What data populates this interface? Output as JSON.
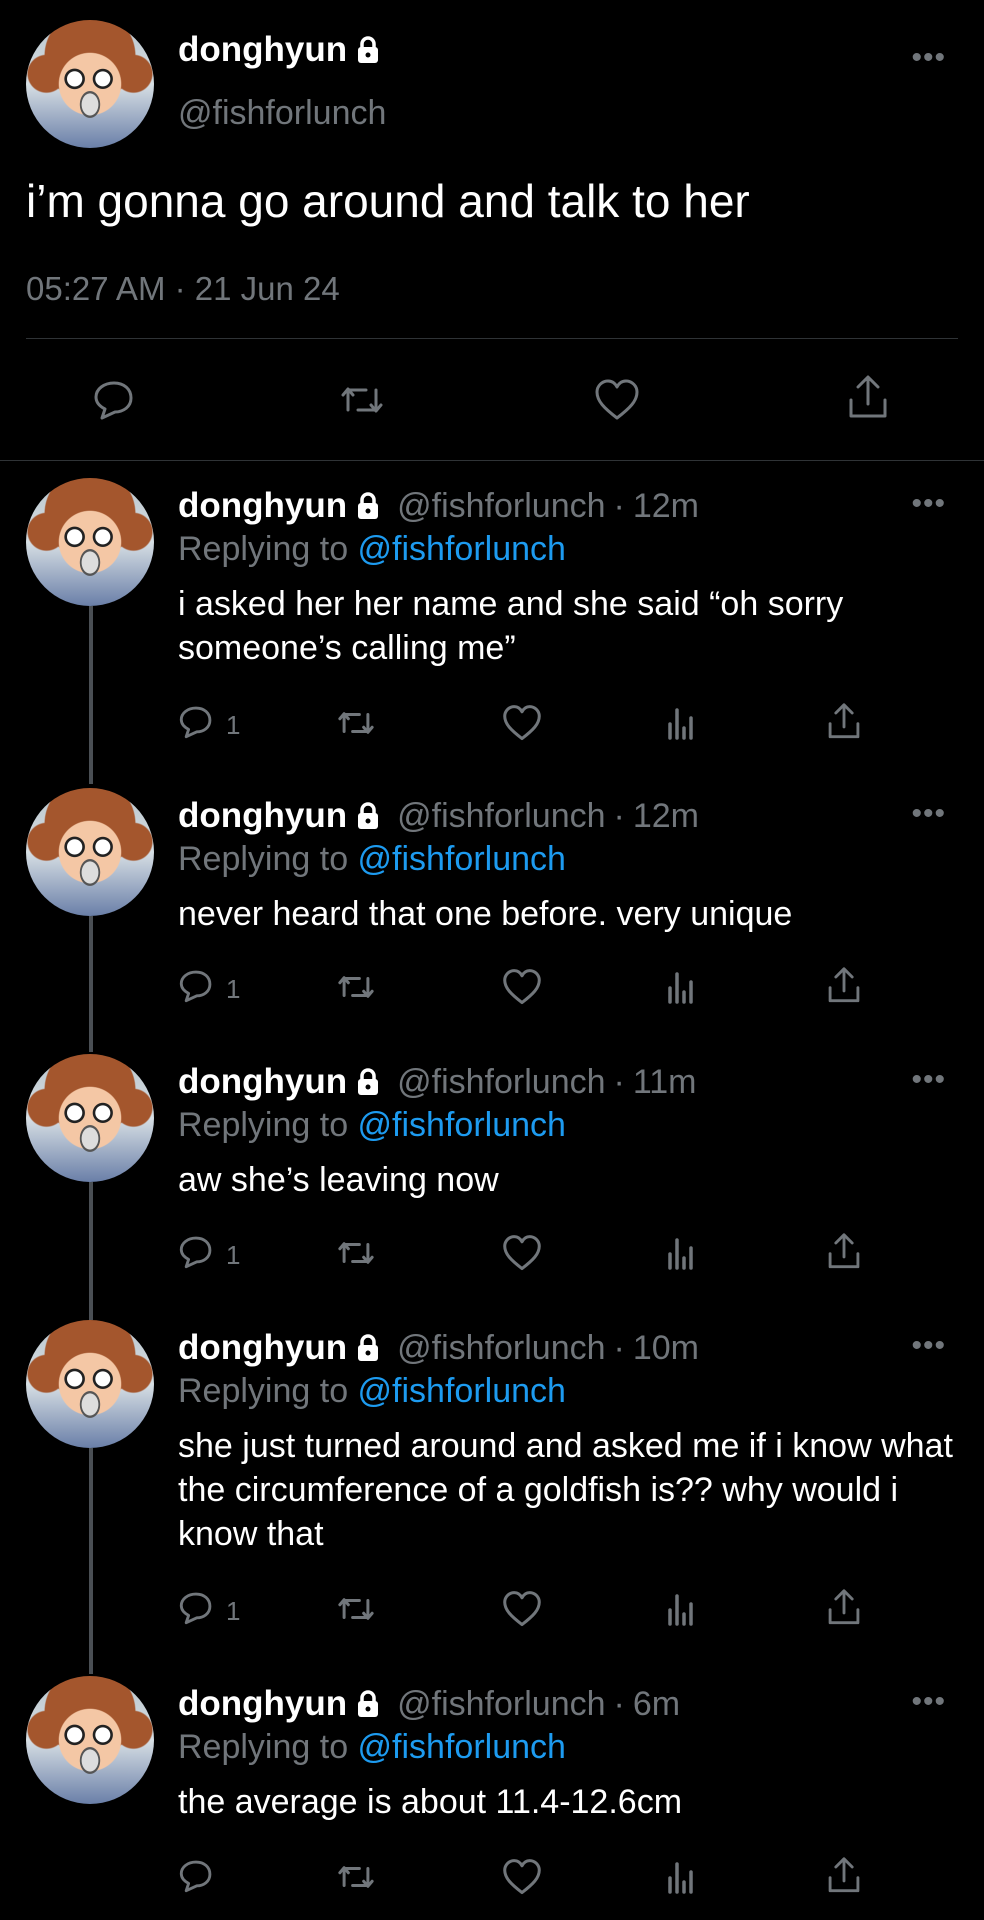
{
  "main_tweet": {
    "name": "donghyun",
    "handle": "@fishforlunch",
    "text": "i’m gonna go around and talk to her",
    "timestamp": "05:27 AM · 21 Jun 24",
    "more_label": "•••"
  },
  "replies": [
    {
      "name": "donghyun",
      "handle": "@fishforlunch",
      "dot": "·",
      "time": "12m",
      "replying_prefix": "Replying to ",
      "replying_to": "@fishforlunch",
      "text": "i asked her her name and she said “oh sorry someone’s calling me”",
      "reply_count": "1",
      "more_label": "•••"
    },
    {
      "name": "donghyun",
      "handle": "@fishforlunch",
      "dot": "·",
      "time": "12m",
      "replying_prefix": "Replying to ",
      "replying_to": "@fishforlunch",
      "text": "never heard that one before. very unique",
      "reply_count": "1",
      "more_label": "•••"
    },
    {
      "name": "donghyun",
      "handle": "@fishforlunch",
      "dot": "·",
      "time": "11m",
      "replying_prefix": "Replying to ",
      "replying_to": "@fishforlunch",
      "text": "aw she’s leaving now",
      "reply_count": "1",
      "more_label": "•••"
    },
    {
      "name": "donghyun",
      "handle": "@fishforlunch",
      "dot": "·",
      "time": "10m",
      "replying_prefix": "Replying to ",
      "replying_to": "@fishforlunch",
      "text": "she just turned around and asked me if i know what the circumference of a goldfish is?? why would i know that",
      "reply_count": "1",
      "more_label": "•••"
    },
    {
      "name": "donghyun",
      "handle": "@fishforlunch",
      "dot": "·",
      "time": "6m",
      "replying_prefix": "Replying to ",
      "replying_to": "@fishforlunch",
      "text": "the average is about 11.4-12.6cm",
      "reply_count": "",
      "more_label": "•••"
    }
  ],
  "colors": {
    "background": "#000000",
    "text": "#ffffff",
    "muted": "#71767b",
    "link": "#1d9bf0",
    "divider": "#2f3336"
  },
  "icons": [
    "reply-icon",
    "retweet-icon",
    "like-icon",
    "views-icon",
    "share-icon",
    "lock-icon",
    "more-icon"
  ]
}
